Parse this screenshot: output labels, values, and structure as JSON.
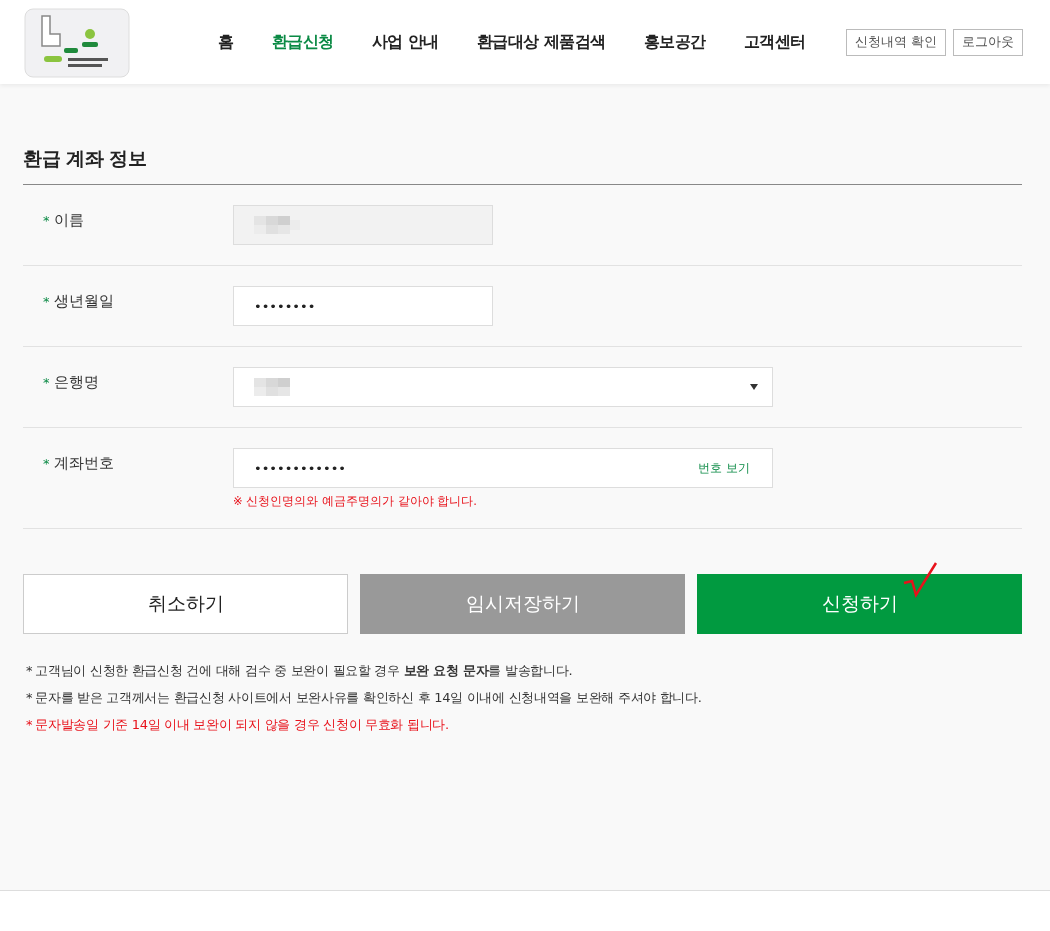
{
  "header": {
    "nav": [
      {
        "label": "홈",
        "selected": false
      },
      {
        "label": "환급신청",
        "selected": true
      },
      {
        "label": "사업 안내",
        "selected": false
      },
      {
        "label": "환급대상 제품검색",
        "selected": false
      },
      {
        "label": "홍보공간",
        "selected": false
      },
      {
        "label": "고객센터",
        "selected": false
      }
    ],
    "buttons": [
      "신청내역 확인",
      "로그아웃"
    ]
  },
  "section": {
    "title": "환급 계좌 정보"
  },
  "fields": [
    {
      "marker": "*",
      "label": "이름",
      "kind": "blurred",
      "readonly": true,
      "wide": false
    },
    {
      "marker": "*",
      "label": "생년월일",
      "kind": "password",
      "value": "••••••••",
      "readonly": false,
      "wide": false
    },
    {
      "marker": "*",
      "label": "은행명",
      "kind": "select",
      "readonly": false,
      "wide": true
    },
    {
      "marker": "*",
      "label": "계좌번호",
      "kind": "password",
      "value": "••••••••••••",
      "readonly": false,
      "wide": true,
      "action": "번호 보기",
      "note": "※ 신청인명의와 예금주명의가 같아야 합니다."
    }
  ],
  "buttons": [
    {
      "label": "취소하기",
      "kind": "cancel"
    },
    {
      "label": "임시저장하기",
      "kind": "save"
    },
    {
      "label": "신청하기",
      "kind": "submit",
      "checked": true
    }
  ],
  "notes": [
    {
      "marker": "*",
      "text": "고객님이 신청한 환급신청 건에 대해 검수 중 보완이 필요할 경우 **보완 요청 문자**를 발송합니다.",
      "kind": "info"
    },
    {
      "marker": "*",
      "text": "문자를 받은 고객께서는 환급신청 사이트에서 보완사유를 확인하신 후 14일 이내에 신청내역을 보완해 주셔야 합니다.",
      "kind": "info"
    },
    {
      "marker": "*",
      "text": "문자발송일 기준 14일 이내 보완이 되지 않을 경우 신청이 무효화 됩니다.",
      "kind": "warning"
    }
  ]
}
